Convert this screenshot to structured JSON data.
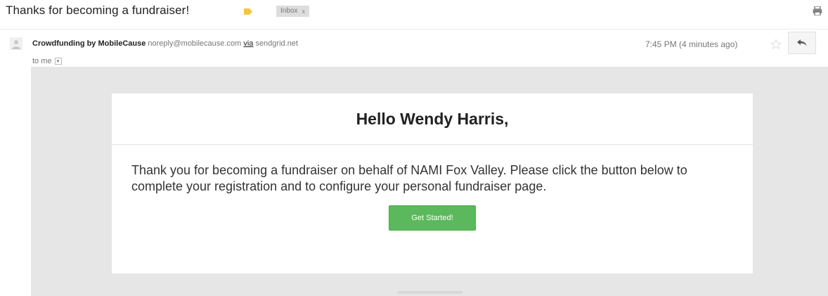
{
  "email": {
    "subject": "Thanks for becoming a fundraiser!",
    "label": {
      "name": "Inbox",
      "remove": "x"
    },
    "sender": {
      "name": "Crowdfunding by MobileCause",
      "email": "noreply@mobilecause.com",
      "via_word": "via",
      "via_domain": "sendgrid.net"
    },
    "recipient": "to me",
    "timestamp": "7:45 PM (4 minutes ago)",
    "body": {
      "greeting": "Hello Wendy Harris,",
      "message": "Thank you for becoming a fundraiser on behalf of NAMI Fox Valley. Please click the button below to complete your registration and to configure your personal fundraiser page.",
      "button_label": "Get Started!"
    }
  },
  "colors": {
    "cta": "#5cb85c",
    "importance_marker": "#f4c542",
    "email_background": "#e6e6e6"
  },
  "icons": [
    "importance-marker-icon",
    "print-icon",
    "avatar-icon",
    "star-icon",
    "reply-icon",
    "dropdown-caret-icon"
  ]
}
